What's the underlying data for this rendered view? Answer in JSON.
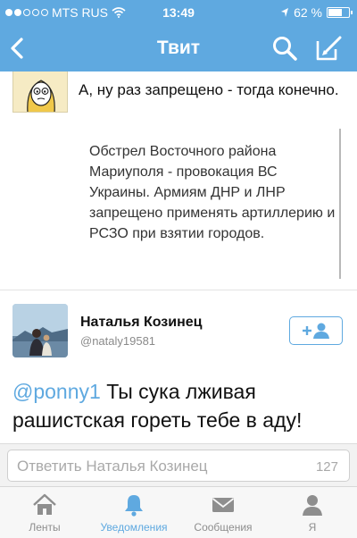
{
  "status_bar": {
    "carrier": "MTS RUS",
    "time": "13:49",
    "battery_percent": "62 %",
    "signal_dots_filled": 2,
    "signal_dots_total": 5,
    "battery_level": 0.62
  },
  "nav": {
    "title": "Твит",
    "back_icon": "chevron-left-icon",
    "search_icon": "search-icon",
    "compose_icon": "compose-icon"
  },
  "reply_tweet": {
    "text": "А, ну раз запрещено - тогда конечно.",
    "avatar_icon": "cartoon-avatar"
  },
  "quoted": {
    "text": "Обстрел Восточного района Мариуполя - провокация ВС Украины. Армиям ДНР и ЛНР запрещено применять артиллерию и РСЗО при взятии городов."
  },
  "author": {
    "name": "Наталья Козинец",
    "handle": "@nataly19581",
    "follow_icon": "add-user-icon"
  },
  "tweet": {
    "mention": "@ponny1",
    "text": " Ты сука лживая рашистская гореть тебе в аду!"
  },
  "reply_box": {
    "placeholder": "Ответить Наталья Козинец",
    "char_count": "127"
  },
  "tabs": [
    {
      "label": "Ленты",
      "icon": "home-icon",
      "active": false
    },
    {
      "label": "Уведомления",
      "icon": "bell-icon",
      "active": true
    },
    {
      "label": "Сообщения",
      "icon": "envelope-icon",
      "active": false
    },
    {
      "label": "Я",
      "icon": "person-icon",
      "active": false
    }
  ],
  "colors": {
    "accent": "#5fa9e0",
    "tab_inactive": "#8e8e8e"
  }
}
